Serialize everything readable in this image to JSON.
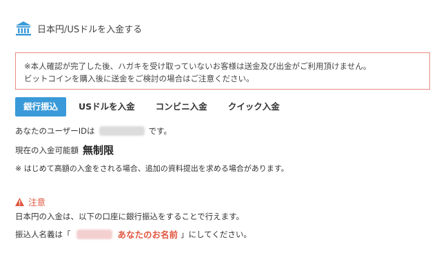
{
  "header": {
    "icon": "bank-icon",
    "title": "日本円/USドルを入金する",
    "accent": "#3a9ad9"
  },
  "notice": {
    "line1": "※本人確認が完了した後、ハガキを受け取っていないお客様は送金及び出金がご利用頂けません。",
    "line2": "ビットコインを購入後に送金をご検討の場合はご注意ください。",
    "border_color": "#e8897f"
  },
  "tabs": [
    {
      "label": "銀行振込",
      "active": true
    },
    {
      "label": "USドルを入金",
      "active": false
    },
    {
      "label": "コンビニ入金",
      "active": false
    },
    {
      "label": "クイック入金",
      "active": false
    }
  ],
  "user": {
    "prefix": "あなたのユーザーIDは",
    "suffix": "です。"
  },
  "deposit": {
    "label": "現在の入金可能額",
    "value": "無制限"
  },
  "note": "※ はじめて高額の入金をされる場合、追加の資料提出を求める場合があります。",
  "warning": {
    "icon": "warning-icon",
    "title": "注意",
    "line1": "日本円の入金は、以下の口座に銀行振込をすることで行えます。",
    "line2_prefix": "振込人名義は「",
    "line2_highlight": "あなたのお名前",
    "line2_suffix": "」にしてください。",
    "color": "#e0563f"
  }
}
